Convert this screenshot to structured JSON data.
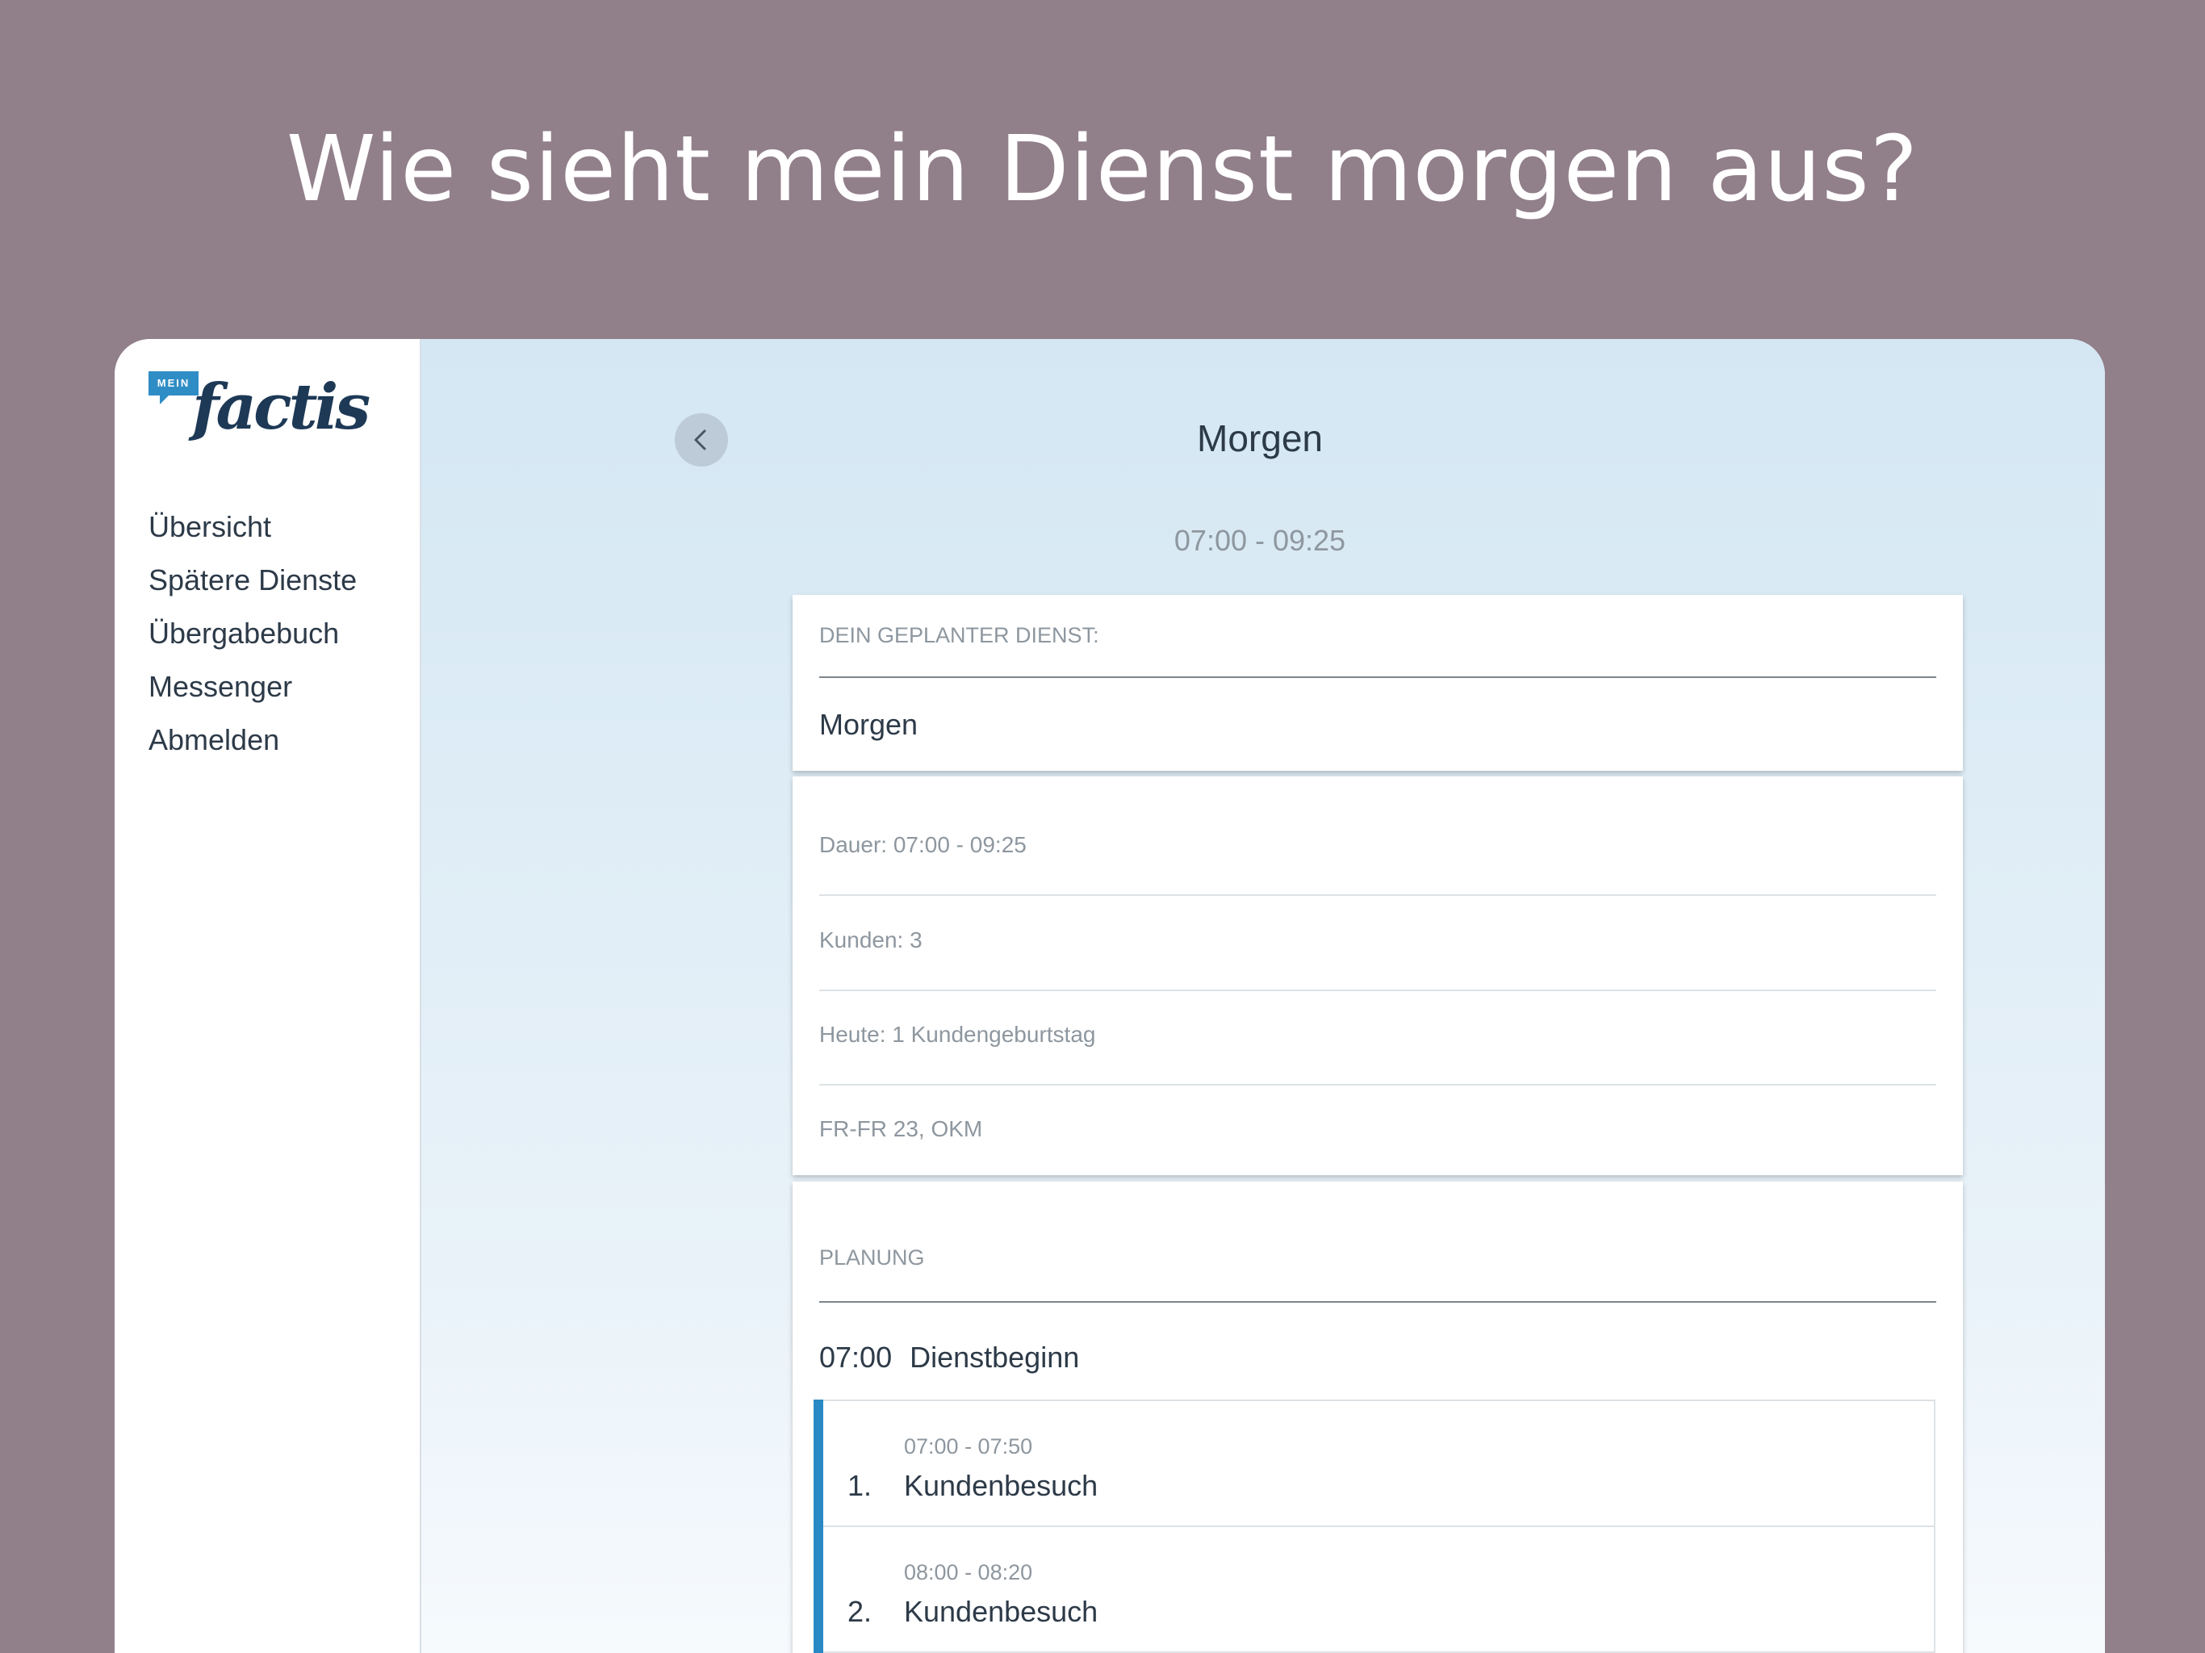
{
  "headline": "Wie sieht mein Dienst morgen aus?",
  "logo": {
    "badge": "MEIN",
    "word": "factis"
  },
  "sidebar": {
    "items": [
      {
        "label": "Übersicht"
      },
      {
        "label": "Spätere Dienste"
      },
      {
        "label": "Übergabebuch"
      },
      {
        "label": "Messenger"
      },
      {
        "label": "Abmelden"
      }
    ]
  },
  "header": {
    "title": "Morgen",
    "time_range": "07:00 - 09:25"
  },
  "planned": {
    "label": "DEIN GEPLANTER DIENST:",
    "value": "Morgen"
  },
  "details": {
    "rows": [
      "Dauer: 07:00 - 09:25",
      "Kunden: 3",
      "Heute: 1 Kundengeburtstag",
      "FR-FR 23, OKM"
    ]
  },
  "planning": {
    "label": "PLANUNG",
    "start_time": "07:00",
    "start_label": "Dienstbeginn",
    "visits": [
      {
        "number": "1.",
        "time": "07:00 - 07:50",
        "name": "Kundenbesuch"
      },
      {
        "number": "2.",
        "time": "08:00 - 08:20",
        "name": "Kundenbesuch"
      }
    ]
  },
  "colors": {
    "background": "#917f8a",
    "accent": "#2889c4",
    "logo_blue": "#2f8dc6",
    "logo_navy": "#1d3956"
  },
  "icons": {
    "back": "chevron-left-icon"
  }
}
